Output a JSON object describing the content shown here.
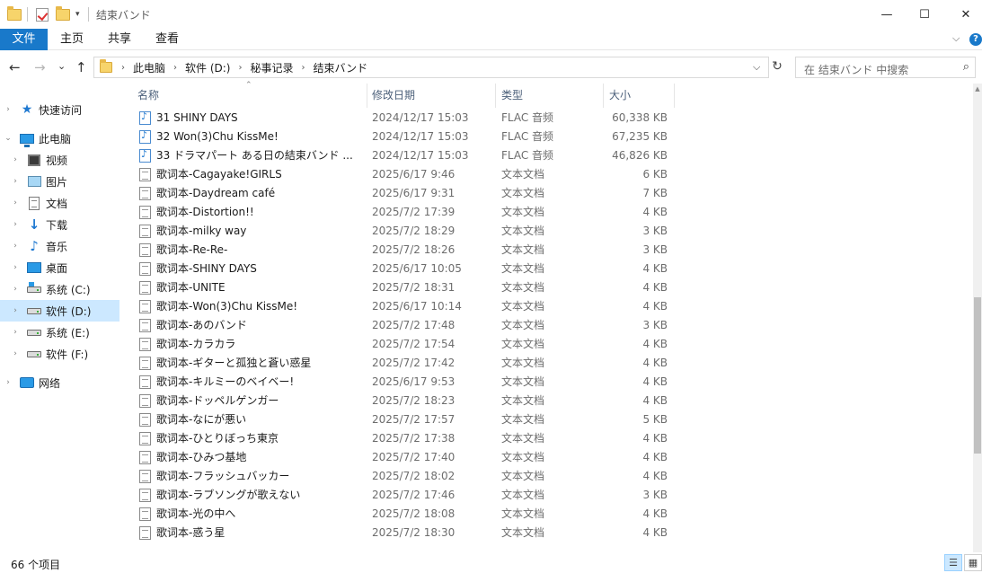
{
  "window": {
    "title": "结束バンド",
    "minimize": "—",
    "maximize": "☐",
    "close": "✕"
  },
  "ribbon": {
    "tabs": [
      "文件",
      "主页",
      "共享",
      "查看"
    ],
    "collapse": "⌵",
    "help": "?"
  },
  "nav": {
    "back": "←",
    "forward": "→",
    "recent": "⌄",
    "up": "↑"
  },
  "address": {
    "crumbs": [
      "此电脑",
      "软件 (D:)",
      "秘事记录",
      "结束バンド"
    ],
    "dropdown": "⌵",
    "refresh": "↻"
  },
  "search": {
    "placeholder": "在 结束バンド 中搜索",
    "icon": "search-icon"
  },
  "sidebar": {
    "items": [
      {
        "label": "快速访问",
        "icon": "star-icon"
      },
      {
        "label": "此电脑",
        "icon": "pc-icon"
      },
      {
        "label": "视频",
        "icon": "video-icon"
      },
      {
        "label": "图片",
        "icon": "picture-icon"
      },
      {
        "label": "文档",
        "icon": "document-icon"
      },
      {
        "label": "下载",
        "icon": "download-icon"
      },
      {
        "label": "音乐",
        "icon": "music-icon"
      },
      {
        "label": "桌面",
        "icon": "desktop-icon"
      },
      {
        "label": "系统 (C:)",
        "icon": "drive-icon"
      },
      {
        "label": "软件 (D:)",
        "icon": "drive-icon"
      },
      {
        "label": "系统 (E:)",
        "icon": "drive-icon"
      },
      {
        "label": "软件 (F:)",
        "icon": "drive-icon"
      },
      {
        "label": "网络",
        "icon": "network-icon"
      }
    ],
    "selected": "软件 (D:)"
  },
  "list": {
    "columns": [
      "名称",
      "修改日期",
      "类型",
      "大小"
    ],
    "sorted_by": "名称",
    "rows": [
      {
        "name": "31 SHINY DAYS",
        "date": "2024/12/17 15:03",
        "type": "FLAC 音频",
        "size": "60,338 KB",
        "kind": "audio"
      },
      {
        "name": "32 Won(3)Chu KissMe!",
        "date": "2024/12/17 15:03",
        "type": "FLAC 音频",
        "size": "67,235 KB",
        "kind": "audio"
      },
      {
        "name": "33 ドラマパート ある日の結束バンド ...",
        "date": "2024/12/17 15:03",
        "type": "FLAC 音频",
        "size": "46,826 KB",
        "kind": "audio"
      },
      {
        "name": "歌词本-Cagayake!GIRLS",
        "date": "2025/6/17 9:46",
        "type": "文本文档",
        "size": "6 KB",
        "kind": "text"
      },
      {
        "name": "歌词本-Daydream café",
        "date": "2025/6/17 9:31",
        "type": "文本文档",
        "size": "7 KB",
        "kind": "text"
      },
      {
        "name": "歌词本-Distortion!!",
        "date": "2025/7/2 17:39",
        "type": "文本文档",
        "size": "4 KB",
        "kind": "text"
      },
      {
        "name": "歌词本-milky way",
        "date": "2025/7/2 18:29",
        "type": "文本文档",
        "size": "3 KB",
        "kind": "text"
      },
      {
        "name": "歌词本-Re-Re-",
        "date": "2025/7/2 18:26",
        "type": "文本文档",
        "size": "3 KB",
        "kind": "text"
      },
      {
        "name": "歌词本-SHINY DAYS",
        "date": "2025/6/17 10:05",
        "type": "文本文档",
        "size": "4 KB",
        "kind": "text"
      },
      {
        "name": "歌词本-UNITE",
        "date": "2025/7/2 18:31",
        "type": "文本文档",
        "size": "4 KB",
        "kind": "text"
      },
      {
        "name": "歌词本-Won(3)Chu KissMe!",
        "date": "2025/6/17 10:14",
        "type": "文本文档",
        "size": "4 KB",
        "kind": "text"
      },
      {
        "name": "歌词本-あのバンド",
        "date": "2025/7/2 17:48",
        "type": "文本文档",
        "size": "3 KB",
        "kind": "text"
      },
      {
        "name": "歌词本-カラカラ",
        "date": "2025/7/2 17:54",
        "type": "文本文档",
        "size": "4 KB",
        "kind": "text"
      },
      {
        "name": "歌词本-ギターと孤独と蒼い惑星",
        "date": "2025/7/2 17:42",
        "type": "文本文档",
        "size": "4 KB",
        "kind": "text"
      },
      {
        "name": "歌词本-キルミーのベイベー!",
        "date": "2025/6/17 9:53",
        "type": "文本文档",
        "size": "4 KB",
        "kind": "text"
      },
      {
        "name": "歌词本-ドッペルゲンガー",
        "date": "2025/7/2 18:23",
        "type": "文本文档",
        "size": "4 KB",
        "kind": "text"
      },
      {
        "name": "歌词本-なにが悪い",
        "date": "2025/7/2 17:57",
        "type": "文本文档",
        "size": "5 KB",
        "kind": "text"
      },
      {
        "name": "歌词本-ひとりぼっち東京",
        "date": "2025/7/2 17:38",
        "type": "文本文档",
        "size": "4 KB",
        "kind": "text"
      },
      {
        "name": "歌词本-ひみつ基地",
        "date": "2025/7/2 17:40",
        "type": "文本文档",
        "size": "4 KB",
        "kind": "text"
      },
      {
        "name": "歌词本-フラッシュバッカー",
        "date": "2025/7/2 18:02",
        "type": "文本文档",
        "size": "4 KB",
        "kind": "text"
      },
      {
        "name": "歌词本-ラブソングが歌えない",
        "date": "2025/7/2 17:46",
        "type": "文本文档",
        "size": "3 KB",
        "kind": "text"
      },
      {
        "name": "歌词本-光の中へ",
        "date": "2025/7/2 18:08",
        "type": "文本文档",
        "size": "4 KB",
        "kind": "text"
      },
      {
        "name": "歌词本-惑う星",
        "date": "2025/7/2 18:30",
        "type": "文本文档",
        "size": "4 KB",
        "kind": "text"
      }
    ]
  },
  "status": {
    "count": "66 个项目"
  },
  "colors": {
    "accent": "#1979ca",
    "selection": "#cce8ff"
  }
}
